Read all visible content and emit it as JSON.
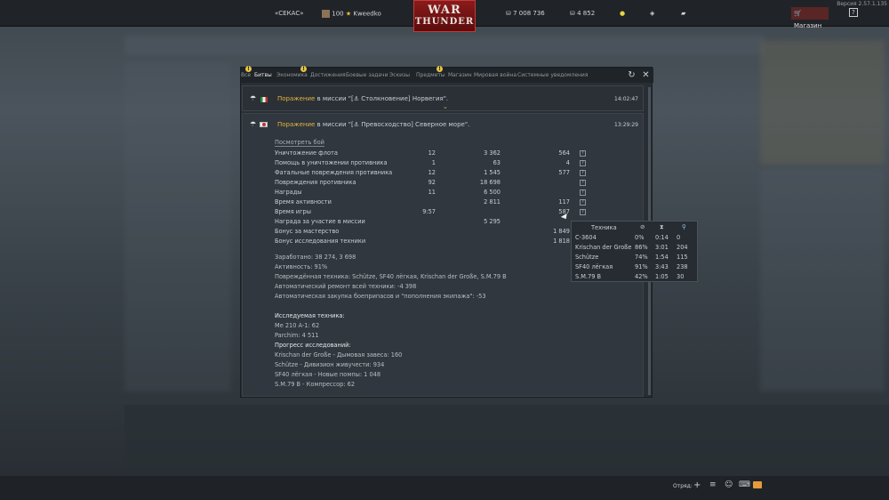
{
  "top": {
    "version": "Версия 2.57.1.135",
    "squad_tag": "«СЕКАС»",
    "player_level": "100",
    "player_name": "Kweedko",
    "silver": "7 008 736",
    "gold": "4 852",
    "shop_label": "Магазин",
    "logo_line1": "WAR",
    "logo_line2": "THUNDER"
  },
  "tabs": [
    "Все",
    "Битвы",
    "Экономика",
    "Достижения",
    "Боевые задачи",
    "Эскизы",
    "Предметы",
    "Магазин",
    "Мировая война",
    "Системные уведомления"
  ],
  "active_tab": "Битвы",
  "msg1": {
    "result": "Поражение",
    "rest": " в миссии \"[",
    "mission": " Столкновение] Норвегия\".",
    "time": "14:02:47"
  },
  "msg2": {
    "result": "Поражение",
    "rest": " в миссии \"[",
    "mission": " Превосходство] Северное море\".",
    "time": "13:29:29",
    "view_battle": "Посмотреть бой"
  },
  "stats": [
    {
      "label": "Уничтожение флота",
      "count": "12",
      "silver": "3 362",
      "rp": "564"
    },
    {
      "label": "Помощь в уничтожении противника",
      "count": "1",
      "silver": "63",
      "rp": "4"
    },
    {
      "label": "Фатальные повреждения противника",
      "count": "12",
      "silver": "1 545",
      "rp": "577"
    },
    {
      "label": "Повреждения противника",
      "count": "92",
      "silver": "18 698",
      "rp": ""
    },
    {
      "label": "Награды",
      "count": "11",
      "silver": "6 500",
      "rp": ""
    },
    {
      "label": "Время активности",
      "count": "",
      "silver": "2 811",
      "rp": "117"
    },
    {
      "label": "Время игры",
      "count": "9:57",
      "silver": "",
      "rp": "587"
    },
    {
      "label": "Награда за участие в миссии",
      "count": "",
      "silver": "5 295",
      "rp": ""
    },
    {
      "label": "Бонус за мастерство",
      "count": "",
      "silver": "",
      "rp": "1 849"
    },
    {
      "label": "Бонус исследования техники",
      "count": "",
      "silver": "",
      "rp": "1 818"
    }
  ],
  "summary": {
    "earned": "Заработано: 38 274, 3 698",
    "activity": "Активность: 91%",
    "damaged": "Повреждённая техника: Schütze, SF40 лёгкая, Krischan der Große, S.M.79 B",
    "repair": "Автоматический ремонт всей техники: -4 398",
    "purchase": "Автоматическая закупка боеприпасов и \"пополнения экипажа\": -53",
    "research_title": "Исследуемая техника:",
    "research1": "Me 210 A-1: 62",
    "research2": "Parchim: 4 511",
    "progress_title": "Прогресс исследований:",
    "progress1": "Krischan der Große - Дымовая завеса: 160",
    "progress2": "Schütze - Дивизион живучести: 934",
    "progress3": "SF40 лёгкая - Новые помпы: 1 048",
    "progress4": "S.M.79 B - Компрессор: 62"
  },
  "popup": {
    "header": "Техника",
    "rows": [
      {
        "name": "C-3604",
        "activity": "0%",
        "time": "0:14",
        "rp": "0"
      },
      {
        "name": "Krischan der Große",
        "activity": "86%",
        "time": "3:01",
        "rp": "204"
      },
      {
        "name": "Schütze",
        "activity": "74%",
        "time": "1:54",
        "rp": "115"
      },
      {
        "name": "SF40 лёгкая",
        "activity": "91%",
        "time": "3:43",
        "rp": "238"
      },
      {
        "name": "S.M.79 B",
        "activity": "42%",
        "time": "1:05",
        "rp": "30"
      }
    ]
  },
  "bottom": {
    "squad_label": "Отряд:"
  },
  "colors": {
    "defeat": "#e5b43c",
    "panel": "#282e34",
    "accent": "#c23b3b"
  }
}
